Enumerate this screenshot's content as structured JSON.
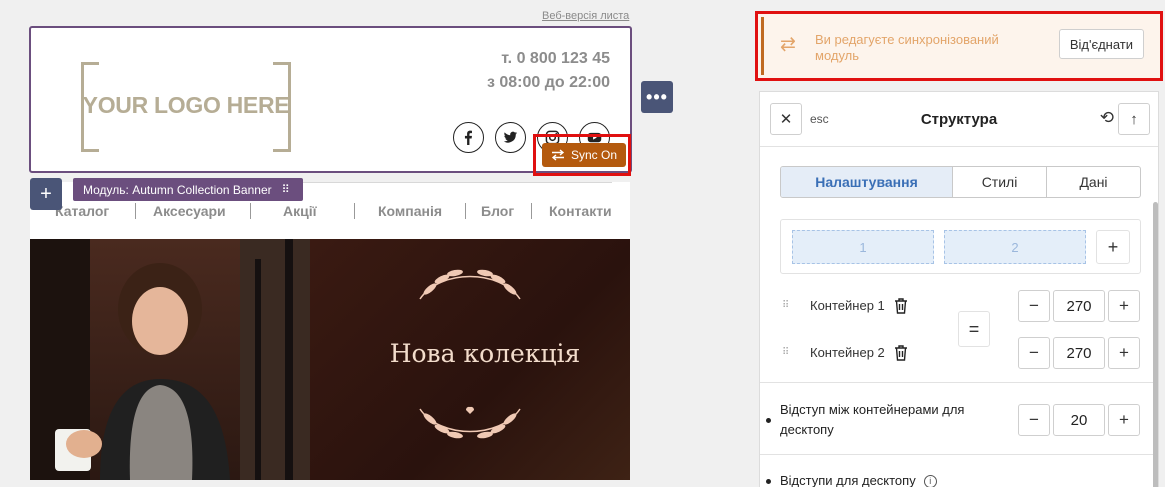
{
  "email": {
    "web_version_link": "Веб-версія листа",
    "logo_text": "YOUR LOGO HERE",
    "phone": "т. 0 800 123 45",
    "hours": "з 08:00 до 22:00",
    "socials": [
      "facebook-icon",
      "twitter-icon",
      "instagram-icon",
      "youtube-icon"
    ],
    "sync_label": "Sync On",
    "module_tag": "Модуль: Autumn Collection Banner",
    "nav": [
      "Каталог",
      "Аксесуари",
      "Акції",
      "Компанія",
      "Блог",
      "Контакти"
    ],
    "banner_title": "Нова колекція"
  },
  "notice": {
    "message": "Ви редагуєте синхронізований модуль",
    "detach_label": "Від'єднати"
  },
  "panel": {
    "esc_label": "esc",
    "title": "Структура",
    "tabs": [
      "Налаштування",
      "Стилі",
      "Дані"
    ],
    "active_tab": "Налаштування",
    "slots": [
      "1",
      "2"
    ],
    "containers": [
      {
        "label": "Контейнер 1",
        "value": "270"
      },
      {
        "label": "Контейнер 2",
        "value": "270"
      }
    ],
    "gap_label": "Відступ між контейнерами для десктопу",
    "gap_value": "20",
    "padding_label": "Відступи для десктопу"
  },
  "colors": {
    "accent_blue": "#3a6fb6",
    "module_purple": "#6b4e7e",
    "sync_orange": "#b45a0e",
    "highlight_red": "#e01010"
  }
}
